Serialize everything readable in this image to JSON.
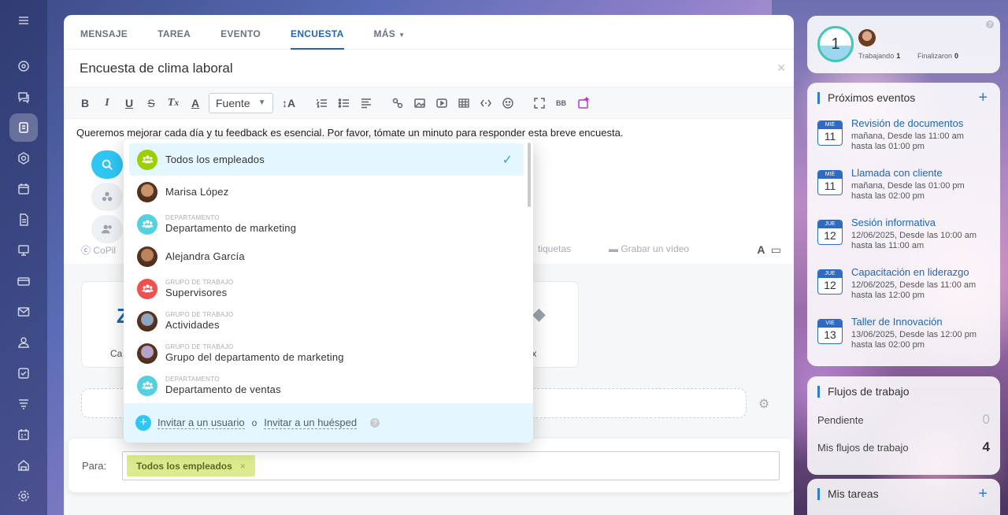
{
  "composer": {
    "tabs": [
      {
        "label": "MENSAJE",
        "active": false
      },
      {
        "label": "TAREA",
        "active": false
      },
      {
        "label": "EVENTO",
        "active": false
      },
      {
        "label": "ENCUESTA",
        "active": true
      },
      {
        "label": "MÁS",
        "active": false
      }
    ],
    "title": "Encuesta de clima laboral",
    "toolbar": {
      "font_label": "Fuente"
    },
    "body_text": "Queremos mejorar cada día y tu feedback es esencial. Por favor, tómate un minuto para responder esta breve encuesta.",
    "copilot_label": "CoPil",
    "tags_label": "tiquetas",
    "video_label": "Grabar un vídeo",
    "card_left_label": "Ca",
    "card_right_label": "box"
  },
  "dropdown": {
    "items": [
      {
        "category": "",
        "name": "Todos los empleados",
        "selected": true,
        "avatar": "group-icon",
        "color": "#9dcf00"
      },
      {
        "category": "",
        "name": "Marisa López",
        "selected": false,
        "avatar": "photo",
        "color": "#c7956b"
      },
      {
        "category": "DEPARTAMENTO",
        "name": "Departamento de marketing",
        "selected": false,
        "avatar": "group-icon",
        "color": "#55d0e0"
      },
      {
        "category": "",
        "name": "Alejandra García",
        "selected": false,
        "avatar": "photo",
        "color": "#b9845e"
      },
      {
        "category": "GRUPO DE TRABAJO",
        "name": "Supervisores",
        "selected": false,
        "avatar": "group-icon",
        "color": "#f0504f"
      },
      {
        "category": "GRUPO DE TRABAJO",
        "name": "Actividades",
        "selected": false,
        "avatar": "photo",
        "color": "#8fa6c2"
      },
      {
        "category": "GRUPO DE TRABAJO",
        "name": "Grupo del departamento de marketing",
        "selected": false,
        "avatar": "photo",
        "color": "#b7a3c9"
      },
      {
        "category": "DEPARTAMENTO",
        "name": "Departamento de ventas",
        "selected": false,
        "avatar": "group-icon",
        "color": "#55d0e0"
      }
    ],
    "invite_user": "Invitar a un usuario",
    "or": "o",
    "invite_guest": "Invitar a un huésped"
  },
  "recipients": {
    "label": "Para:",
    "chip": "Todos los empleados"
  },
  "status": {
    "count": "1",
    "working_label": "Trabajando",
    "working_value": "1",
    "finished_label": "Finalizaron",
    "finished_value": "0"
  },
  "events": {
    "title": "Próximos eventos",
    "items": [
      {
        "dow": "MIÉ",
        "day": "11",
        "title": "Revisión de documentos",
        "line1": "mañana, Desde las 11:00 am",
        "line2": "hasta las 01:00 pm"
      },
      {
        "dow": "MIÉ",
        "day": "11",
        "title": "Llamada con cliente",
        "line1": "mañana, Desde las 01:00 pm",
        "line2": "hasta las 02:00 pm"
      },
      {
        "dow": "JUE",
        "day": "12",
        "title": "Sesión informativa",
        "line1": "12/06/2025, Desde las 10:00 am",
        "line2": "hasta las 11:00 am"
      },
      {
        "dow": "JUE",
        "day": "12",
        "title": "Capacitación en liderazgo",
        "line1": "12/06/2025, Desde las 11:00 am",
        "line2": "hasta las 12:00 pm"
      },
      {
        "dow": "VIE",
        "day": "13",
        "title": "Taller de Innovación",
        "line1": "13/06/2025, Desde las 12:00 pm",
        "line2": "hasta las 02:00 pm"
      }
    ]
  },
  "workflows": {
    "title": "Flujos de trabajo",
    "pending_label": "Pendiente",
    "pending_value": "0",
    "mine_label": "Mis flujos de trabajo",
    "mine_value": "4"
  },
  "tasks": {
    "title": "Mis tareas"
  }
}
